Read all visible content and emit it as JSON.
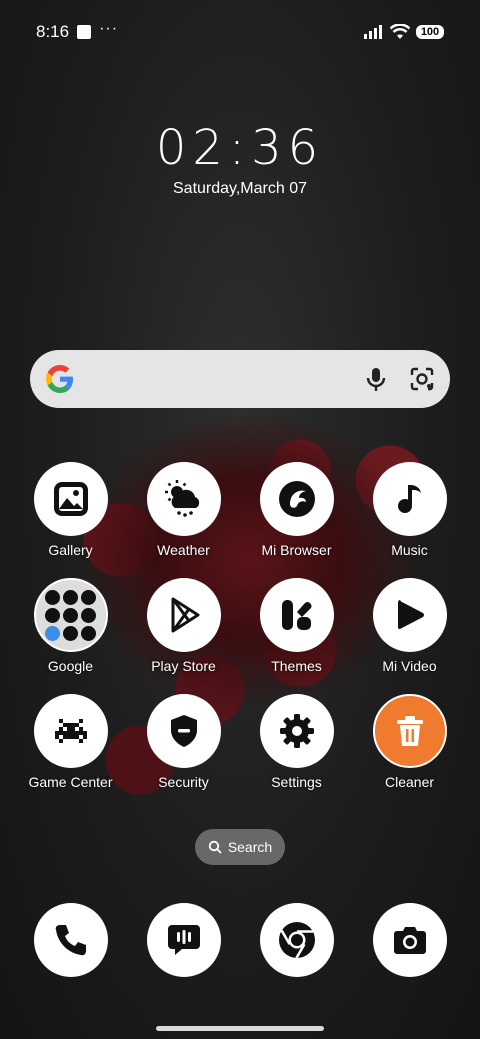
{
  "status_bar": {
    "time": "8:16",
    "overflow": "···",
    "battery": "100"
  },
  "lock_clock": {
    "time": "02:36",
    "date": "Saturday,March 07"
  },
  "search_bar": {
    "icons": [
      "google-logo-icon",
      "microphone-icon",
      "lens-icon"
    ]
  },
  "apps": [
    {
      "label": "Gallery",
      "icon": "gallery-icon"
    },
    {
      "label": "Weather",
      "icon": "weather-icon"
    },
    {
      "label": "Mi Browser",
      "icon": "mi-browser-icon"
    },
    {
      "label": "Music",
      "icon": "music-icon"
    },
    {
      "label": "Google",
      "icon": "google-folder-icon"
    },
    {
      "label": "Play Store",
      "icon": "play-store-icon"
    },
    {
      "label": "Themes",
      "icon": "themes-icon"
    },
    {
      "label": "Mi Video",
      "icon": "mi-video-icon"
    },
    {
      "label": "Game Center",
      "icon": "game-center-icon"
    },
    {
      "label": "Security",
      "icon": "security-icon"
    },
    {
      "label": "Settings",
      "icon": "settings-icon"
    },
    {
      "label": "Cleaner",
      "icon": "cleaner-icon"
    }
  ],
  "app_search": {
    "label": "Search"
  },
  "dock": [
    "phone-icon",
    "messages-icon",
    "chrome-icon",
    "camera-icon"
  ],
  "colors": {
    "cleaner_accent": "#F07A2E",
    "icon_background": "#FFFFFF",
    "icon_glyph": "#111111"
  }
}
